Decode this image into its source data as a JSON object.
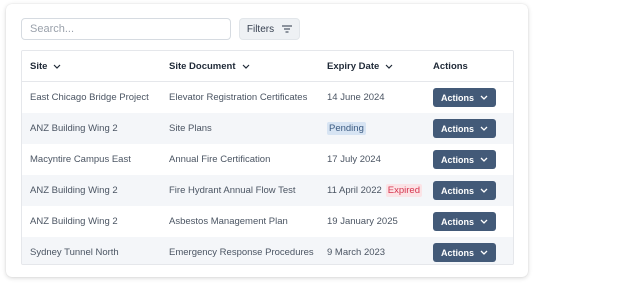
{
  "search": {
    "placeholder": "Search..."
  },
  "filters": {
    "label": "Filters"
  },
  "table": {
    "headers": {
      "site": "Site",
      "document": "Site Document",
      "expiry": "Expiry Date",
      "actions": "Actions"
    },
    "rows": [
      {
        "site": "East Chicago Bridge Project",
        "document": "Elevator Registration Certificates",
        "expiry": "14 June 2024",
        "status": "",
        "action": "Actions"
      },
      {
        "site": "ANZ Building Wing 2",
        "document": "Site Plans",
        "expiry": "",
        "status": "Pending",
        "action": "Actions"
      },
      {
        "site": "Macyntire Campus East",
        "document": "Annual Fire Certification",
        "expiry": "17 July 2024",
        "status": "",
        "action": "Actions"
      },
      {
        "site": "ANZ Building Wing 2",
        "document": "Fire Hydrant Annual Flow Test",
        "expiry": "11 April 2022",
        "status": "Expired",
        "action": "Actions"
      },
      {
        "site": "ANZ Building Wing 2",
        "document": "Asbestos Management Plan",
        "expiry": "19 January 2025",
        "status": "",
        "action": "Actions"
      },
      {
        "site": "Sydney Tunnel North",
        "document": "Emergency Response Procedures",
        "expiry": "9 March 2023",
        "status": "",
        "action": "Actions"
      }
    ]
  },
  "colors": {
    "action_button": "#435a78",
    "pending_bg": "#d7e4f3",
    "expired_bg": "#fbe3e6",
    "expired_text": "#d6344e",
    "row_alt": "#f4f6f9"
  },
  "icons": {
    "filters": "filter-lines-icon",
    "sort": "chevron-down-icon",
    "action": "chevron-down-icon"
  }
}
